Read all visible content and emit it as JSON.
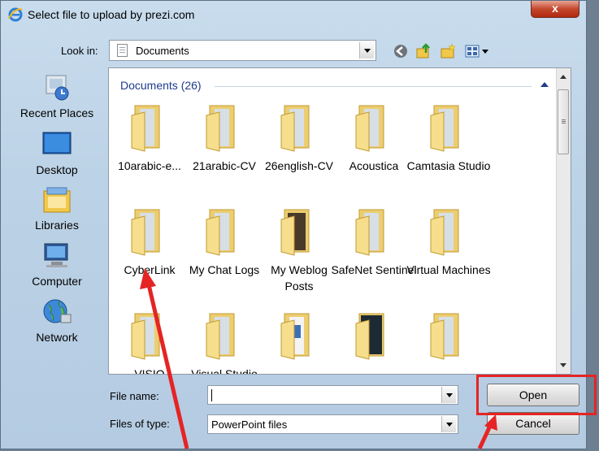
{
  "window": {
    "title": "Select file to upload by prezi.com",
    "close_label": "x"
  },
  "toolbar": {
    "look_in_label": "Look in:",
    "look_in_value": "Documents"
  },
  "places": [
    {
      "label": "Recent Places",
      "icon": "recent-places-icon"
    },
    {
      "label": "Desktop",
      "icon": "desktop-icon"
    },
    {
      "label": "Libraries",
      "icon": "libraries-icon"
    },
    {
      "label": "Computer",
      "icon": "computer-icon"
    },
    {
      "label": "Network",
      "icon": "network-icon"
    }
  ],
  "files": {
    "group_label": "Documents (26)",
    "items": [
      {
        "name": "10arabic-e...",
        "icon": "folder-icon"
      },
      {
        "name": "21arabic-CV",
        "icon": "folder-icon"
      },
      {
        "name": "26english-CV",
        "icon": "folder-icon"
      },
      {
        "name": "Acoustica",
        "icon": "folder-icon"
      },
      {
        "name": "Camtasia Studio",
        "icon": "folder-icon"
      },
      {
        "name": "CyberLink",
        "icon": "folder-icon"
      },
      {
        "name": "My Chat Logs",
        "icon": "folder-icon"
      },
      {
        "name": "My Weblog Posts",
        "icon": "folder-icon"
      },
      {
        "name": "SafeNet Sentinel",
        "icon": "folder-icon"
      },
      {
        "name": "Virtual Machines",
        "icon": "folder-icon"
      },
      {
        "name": "VISIO",
        "icon": "folder-icon"
      },
      {
        "name": "Visual Studio",
        "icon": "folder-icon"
      },
      {
        "name": "...",
        "icon": "folder-icon"
      },
      {
        "name": "...",
        "icon": "folder-icon"
      },
      {
        "name": "...",
        "icon": "folder-icon"
      }
    ]
  },
  "form": {
    "file_name_label": "File name:",
    "file_name_value": "",
    "file_type_label": "Files of type:",
    "file_type_value": "PowerPoint files",
    "open_label": "Open",
    "cancel_label": "Cancel"
  },
  "colors": {
    "annotation": "#e52424",
    "group_header": "#1e3b8c",
    "folder": "#f3d77a"
  }
}
